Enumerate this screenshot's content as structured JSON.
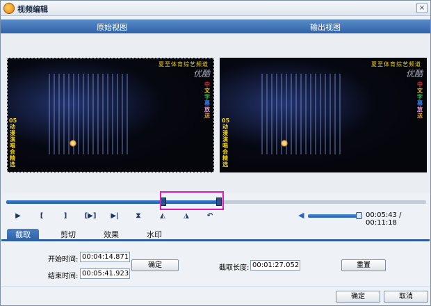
{
  "window": {
    "title": "视频编辑",
    "close_glyph": "×"
  },
  "view_headers": {
    "original": "原始视图",
    "output": "输出视图"
  },
  "video": {
    "top_caption": "夏至体育综艺频道",
    "logo": "优酷",
    "vertical_left": [
      "05",
      "动",
      "漫",
      "演",
      "唱",
      "会",
      "精",
      "选"
    ],
    "vertical_right": [
      "中",
      "文",
      "字",
      "幕",
      "放",
      "送"
    ]
  },
  "timeline": {
    "played_fraction": 0.375,
    "selection_end_fraction": 0.507
  },
  "controls": {
    "play": "▶",
    "mark_in": "[",
    "mark_out": "]",
    "play_selection": "[▶]",
    "next_frame": "▶|",
    "split": "⧗",
    "rotate_left": "◭",
    "rotate_right": "◮",
    "undo": "↶"
  },
  "volume": {
    "icon": "speaker-icon",
    "level": 1.0
  },
  "time_display": "00:05:43 / 00:11:18",
  "tabs": [
    "截取",
    "剪切",
    "效果",
    "水印"
  ],
  "active_tab": 0,
  "trim": {
    "start_label": "开始时间:",
    "start_value": "00:04:14.871",
    "end_label": "结束时间:",
    "end_value": "00:05:41.923",
    "confirm_label": "确定",
    "length_label": "截取长度:",
    "length_value": "00:01:27.052",
    "reset_label": "重置"
  },
  "footer": {
    "ok_label": "确定",
    "cancel_label": "取消"
  },
  "colors": {
    "accent": "#2d5ea4",
    "selection_highlight": "#e01ab8"
  }
}
